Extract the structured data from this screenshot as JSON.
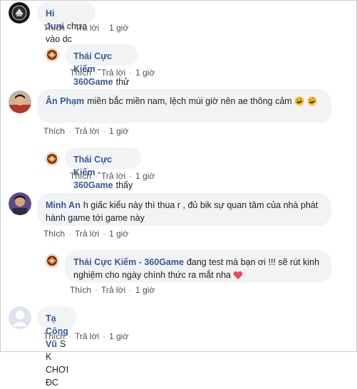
{
  "labels": {
    "like": "Thích",
    "reply": "Trả lời",
    "sep": "·"
  },
  "colors": {
    "name": "#385898",
    "bubble": "#f2f3f5",
    "action": "#4b4f56"
  },
  "comments": [
    {
      "author": "Hi Juni",
      "text": "chưa vào dc",
      "time": "1 giờ"
    },
    {
      "author": "Thái Cực Kiếm - 360Game",
      "text": "thử vào lại nào baby",
      "time": "1 giờ"
    },
    {
      "author": "Ân Phạm",
      "text": "miền bắc miền nam, lệch múi giờ nên ae thông cảm",
      "time": "1 giờ",
      "emoji": "rofl-emoji"
    },
    {
      "author": "Thái Cực Kiếm - 360Game",
      "text": "thấy ghét, chọc hoài",
      "time": "1 giờ"
    },
    {
      "author": "Minh An",
      "text": "h giấc kiểu này thì thua r , đủ bik sự quan tâm của nhà phát hành game tới game này",
      "time": "1 giờ"
    },
    {
      "author": "Thái Cực Kiếm - 360Game",
      "text": "đang test mà bạn ơi !!! sẽ rút kinh nghiệm cho ngày chính thức ra mắt nha",
      "time": "1 giờ",
      "emoji": "heart-emoji"
    },
    {
      "author": "Tạ Công Vũ",
      "text": "S K CHƠI ĐC",
      "time": "1 giờ"
    }
  ]
}
